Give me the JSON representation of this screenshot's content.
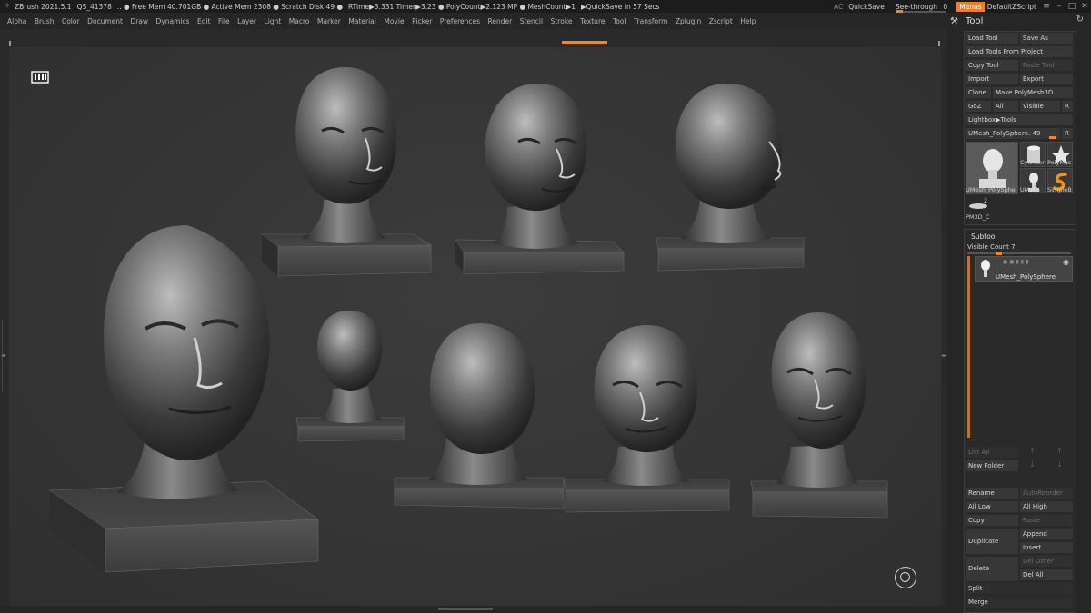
{
  "titlebar": {
    "app": "ZBrush 2021.5.1",
    "qs": "QS_41378",
    "free_mem": ".. ● Free Mem 40.701GB ● Active Mem 2308 ● Scratch Disk 49 ●",
    "rtime": "RTime▶3.331 Timer▶3.23 ● PolyCount▶2.123 MP ● MeshCount▶1",
    "quicksave_in": "▶QuickSave In 57 Secs",
    "ac": "AC",
    "quicksave": "QuickSave",
    "see_through_label": "See-through",
    "see_through_value": "0",
    "see_through_level": 0,
    "menus": "Menus",
    "default_zscript": "DefaultZScript"
  },
  "menubar": {
    "items": [
      "Alpha",
      "Brush",
      "Color",
      "Document",
      "Draw",
      "Dynamics",
      "Edit",
      "File",
      "Layer",
      "Light",
      "Macro",
      "Marker",
      "Material",
      "Movie",
      "Picker",
      "Preferences",
      "Render",
      "Stencil",
      "Stroke",
      "Texture",
      "Tool",
      "Transform",
      "Zplugin",
      "Zscript",
      "Help"
    ]
  },
  "tool_palette": {
    "title": "Tool",
    "load_tool": "Load Tool",
    "save_as": "Save As",
    "load_from_project": "Load Tools From Project",
    "copy_tool": "Copy Tool",
    "paste_tool": "Paste Tool",
    "import": "Import",
    "export": "Export",
    "clone": "Clone",
    "make_polymesh": "Make PolyMesh3D",
    "goz": "GoZ",
    "all": "All",
    "visible": "Visible",
    "r": "R",
    "lightbox_tools": "Lightbox▶Tools",
    "current_tool": "UMesh_PolySphere. 49",
    "current_r": "R",
    "thumbs": {
      "main": "UMesh_PolySphe",
      "cylinder": "Cylinder",
      "polymesh": "PolyMes",
      "umesh": "UMesh_",
      "simpleb": "SimpleB",
      "pm3d": "PM3D_C",
      "pm3d_count": "2"
    }
  },
  "subtool": {
    "title": "Subtool",
    "visible_count": "Visible Count 7",
    "visible_count_level": 0.3,
    "item_name": "UMesh_PolySphere",
    "list_all": "List All",
    "new_folder": "New Folder",
    "rename": "Rename",
    "auto_reorder": "AutoReorder",
    "all_low": "All Low",
    "all_high": "All High",
    "copy": "Copy",
    "paste": "Paste",
    "append": "Append",
    "duplicate": "Duplicate",
    "insert": "Insert",
    "delete": "Delete",
    "del_other": "Del Other",
    "del_all": "Del All",
    "split": "Split",
    "merge": "Merge"
  },
  "colors": {
    "accent": "#e88a2a",
    "panel_bg": "#262626",
    "button_bg": "#373737",
    "canvas_bg": "#363636"
  }
}
